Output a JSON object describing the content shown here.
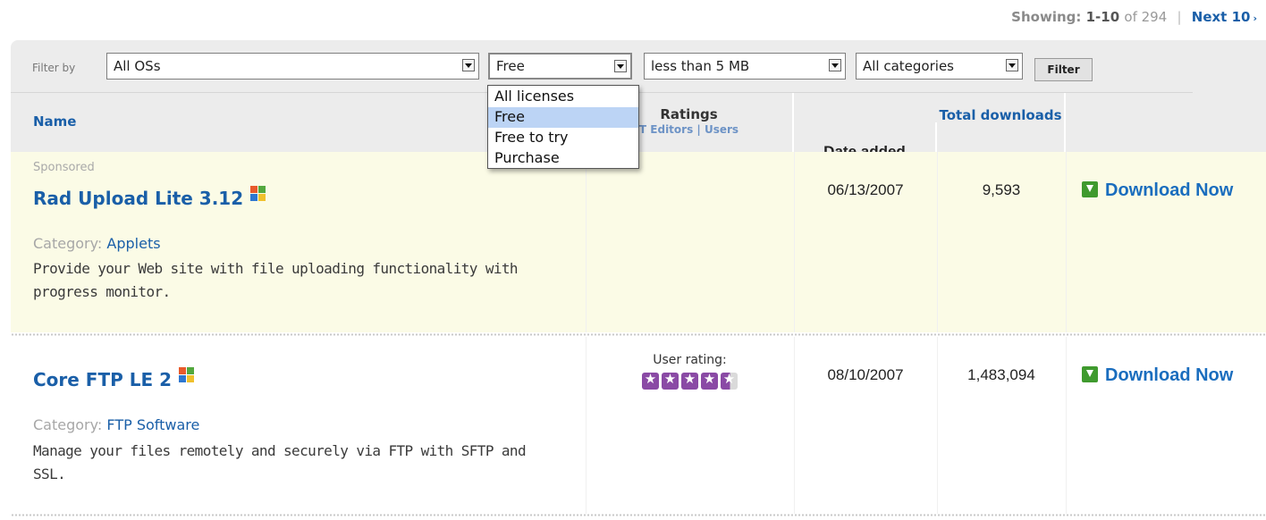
{
  "pagination": {
    "label": "Showing:",
    "range": "1-10",
    "of_total": "of 294",
    "separator": "|",
    "next_label": "Next 10",
    "next_arrow": "›"
  },
  "filter": {
    "label": "Filter by",
    "os": {
      "value": "All OSs"
    },
    "license": {
      "value": "Free",
      "options": [
        "All licenses",
        "Free",
        "Free to try",
        "Purchase"
      ],
      "highlighted_index": 1,
      "open": true
    },
    "size": {
      "value": "less than 5 MB"
    },
    "category": {
      "value": "All categories"
    },
    "button_label": "Filter"
  },
  "columns": {
    "name": "Name",
    "ratings": "Ratings",
    "ratings_sub": "T Editors | Users",
    "date": "Date added",
    "downloads": "Total downloads"
  },
  "results": [
    {
      "sponsored_label": "Sponsored",
      "title": "Rad Upload Lite 3.12",
      "icon": "windows-icon",
      "category_label": "Category:",
      "category": "Applets",
      "description": "Provide your Web site with file uploading functionality with progress monitor.",
      "date": "06/13/2007",
      "downloads": "9,593",
      "action_label": "Download Now"
    },
    {
      "title": "Core FTP LE 2",
      "icon": "windows-icon",
      "category_label": "Category:",
      "category": "FTP Software",
      "description": "Manage your files remotely and securely via FTP with SFTP and SSL.",
      "rating_label": "User rating:",
      "user_rating": 4.5,
      "rating_max": 5,
      "date": "08/10/2007",
      "downloads": "1,483,094",
      "action_label": "Download Now"
    }
  ],
  "colors": {
    "link": "#1a5fa8",
    "sponsored_bg": "#fbfbe6",
    "panel_bg": "#ececec",
    "star": "#8a4aa5",
    "download_icon": "#3f9a2e"
  }
}
